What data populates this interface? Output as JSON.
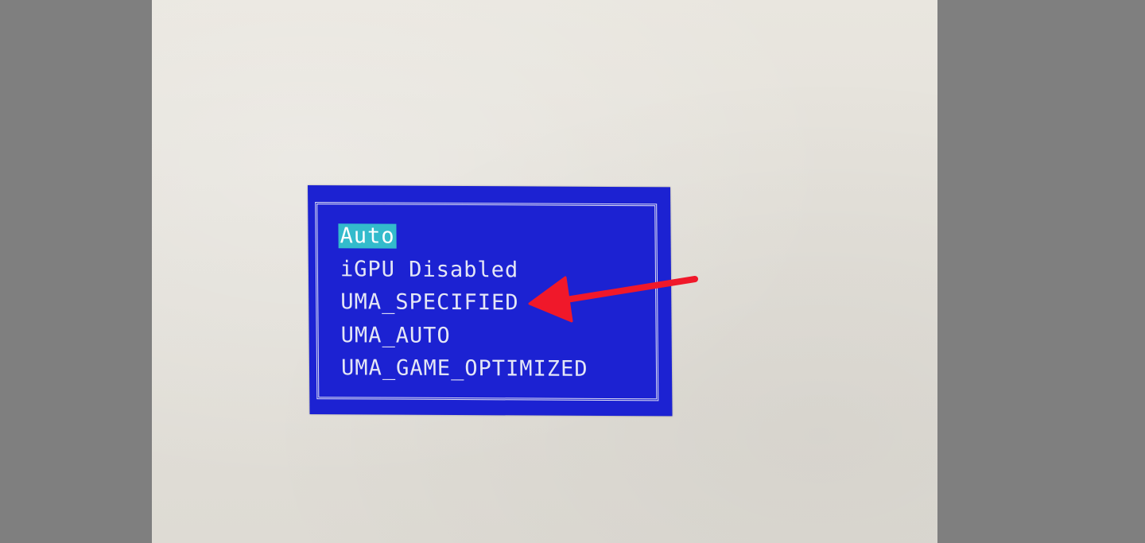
{
  "bios_menu": {
    "options": [
      {
        "label": "Auto",
        "selected": true
      },
      {
        "label": "iGPU Disabled",
        "selected": false
      },
      {
        "label": "UMA_SPECIFIED",
        "selected": false
      },
      {
        "label": "UMA_AUTO",
        "selected": false
      },
      {
        "label": "UMA_GAME_OPTIMIZED",
        "selected": false
      }
    ],
    "colors": {
      "background": "#1c22d2",
      "text": "#e4e6f6",
      "highlight": "#33bbcc"
    }
  },
  "annotation": {
    "icon": "red-arrow-icon",
    "points_to_option": "UMA_SPECIFIED",
    "color": "#f0182a"
  }
}
